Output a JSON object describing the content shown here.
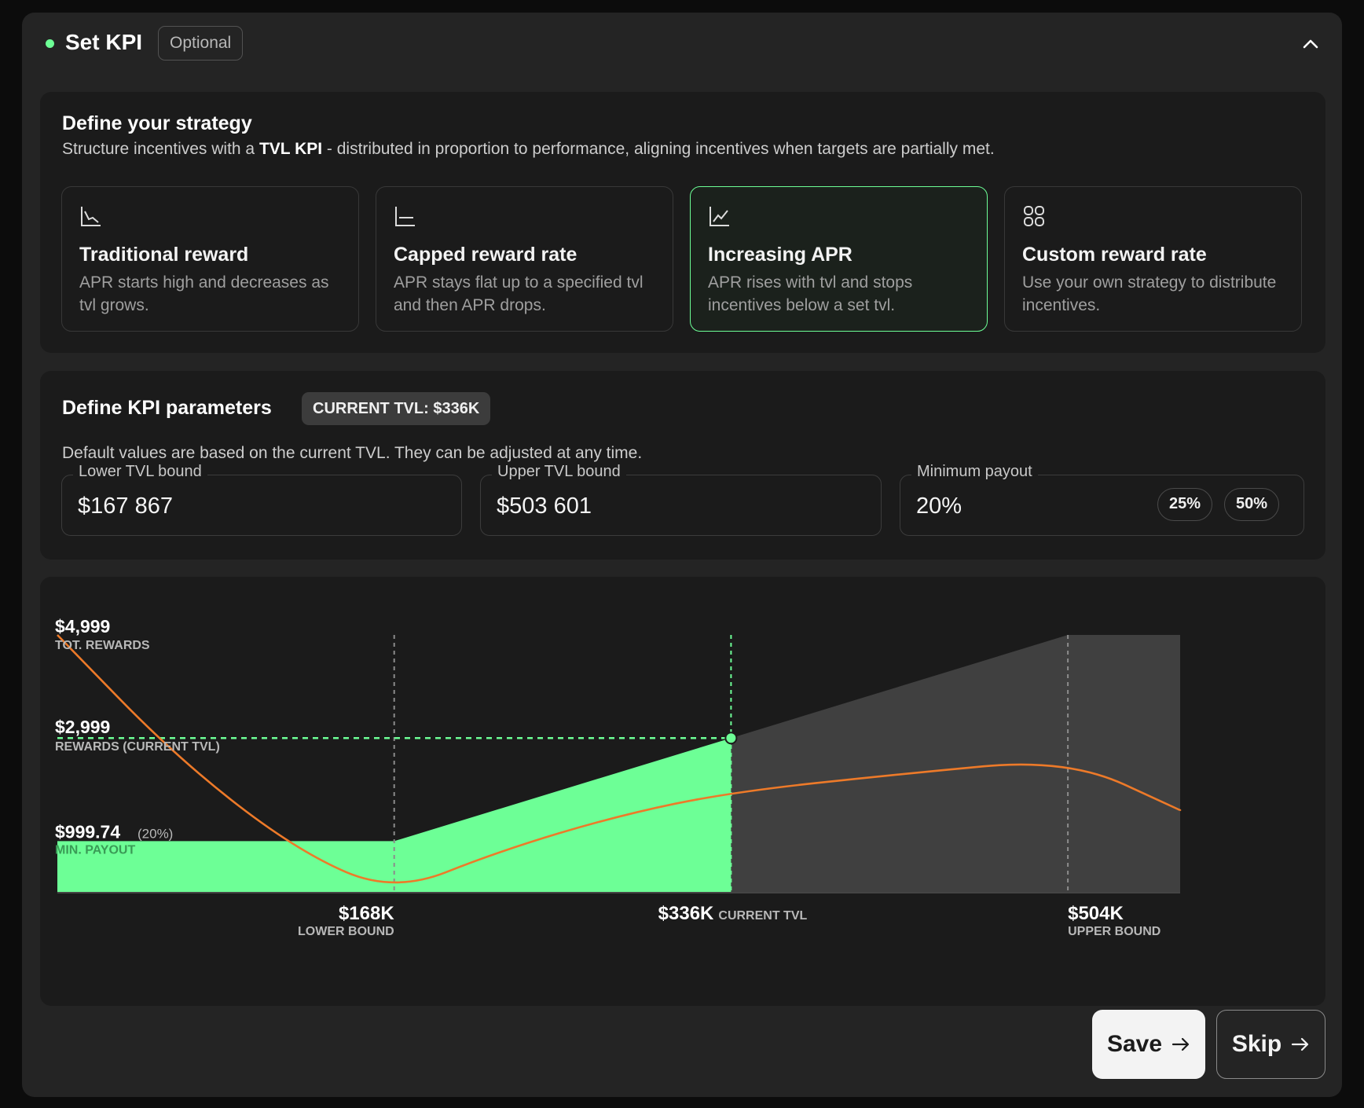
{
  "header": {
    "title": "Set KPI",
    "badge": "Optional"
  },
  "strategy": {
    "title": "Define your strategy",
    "desc_prefix": "Structure incentives with a ",
    "desc_bold": "TVL KPI",
    "desc_suffix": " - distributed in proportion to performance, aligning incentives when targets are partially met.",
    "options": [
      {
        "title": "Traditional reward",
        "desc": "APR starts high and decreases as tvl grows.",
        "icon": "chart-decreasing-icon"
      },
      {
        "title": "Capped reward rate",
        "desc": "APR stays flat up to a specified tvl and then APR drops.",
        "icon": "chart-flat-icon"
      },
      {
        "title": "Increasing APR",
        "desc": "APR rises with tvl and stops incentives below a set tvl.",
        "icon": "chart-increasing-icon",
        "selected": true
      },
      {
        "title": "Custom reward rate",
        "desc": "Use your own strategy to distribute incentives.",
        "icon": "grid-icon"
      }
    ]
  },
  "kpi": {
    "title": "Define KPI parameters",
    "current_tvl_badge": "CURRENT TVL: $336K",
    "desc": "Default values are based on the current TVL. They can be adjusted at any time.",
    "fields": {
      "lower": {
        "label": "Lower TVL bound",
        "value": "$167 867"
      },
      "upper": {
        "label": "Upper TVL bound",
        "value": "$503 601"
      },
      "min_payout": {
        "label": "Minimum payout",
        "value": "20%",
        "chips": [
          "25%",
          "50%"
        ]
      }
    }
  },
  "chart_data": {
    "type": "area",
    "x_labels": {
      "lower": {
        "value": "$168K",
        "caption": "LOWER BOUND"
      },
      "current": {
        "value": "$336K",
        "caption": "CURRENT TVL"
      },
      "upper": {
        "value": "$504K",
        "caption": "UPPER BOUND"
      }
    },
    "y_labels": {
      "total": {
        "value": "$4,999",
        "caption": "TOT. REWARDS"
      },
      "current": {
        "value": "$2,999",
        "caption": "REWARDS (CURRENT TVL)"
      },
      "min": {
        "value": "$999.74",
        "percent": "(20%)",
        "caption": "MIN. PAYOUT"
      }
    },
    "xlim": [
      0,
      560000
    ],
    "ylim": [
      0,
      4999
    ],
    "rewards_area": [
      [
        0,
        999.74
      ],
      [
        168000,
        999.74
      ],
      [
        336000,
        2999
      ],
      [
        504000,
        4999
      ],
      [
        560000,
        4999
      ]
    ],
    "apr_line": [
      [
        0,
        4999
      ],
      [
        60000,
        2600
      ],
      [
        120000,
        800
      ],
      [
        168000,
        0
      ],
      [
        220000,
        800
      ],
      [
        280000,
        1500
      ],
      [
        336000,
        1950
      ],
      [
        420000,
        2300
      ],
      [
        504000,
        2600
      ],
      [
        560000,
        1600
      ]
    ],
    "current_tvl": 336000,
    "current_rewards": 2999,
    "colors": {
      "area": "#6dff96",
      "area_grey": "#404040",
      "line": "#ed7a29",
      "guide_current": "#6dff96",
      "guide": "#8c8c8c",
      "axis": "#454545"
    }
  },
  "actions": {
    "save": "Save",
    "skip": "Skip"
  }
}
